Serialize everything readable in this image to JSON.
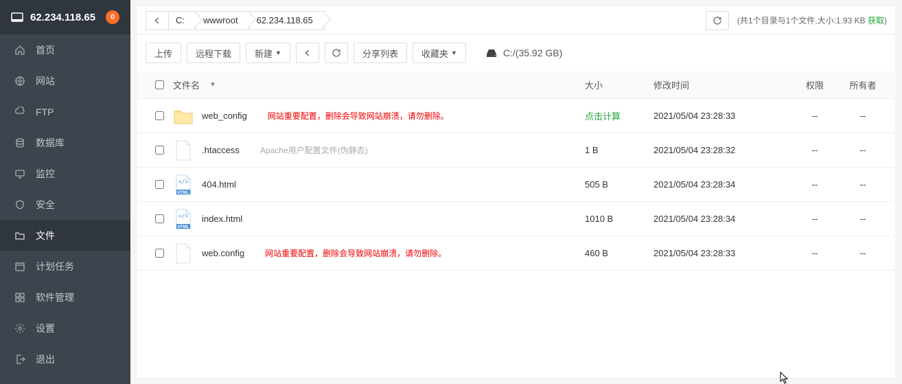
{
  "header": {
    "ip": "62.234.118.65",
    "badge": "0"
  },
  "sidebar": {
    "items": [
      {
        "key": "home",
        "label": "首页"
      },
      {
        "key": "site",
        "label": "网站"
      },
      {
        "key": "ftp",
        "label": "FTP"
      },
      {
        "key": "db",
        "label": "数据库"
      },
      {
        "key": "monitor",
        "label": "监控"
      },
      {
        "key": "security",
        "label": "安全"
      },
      {
        "key": "files",
        "label": "文件",
        "active": true
      },
      {
        "key": "cron",
        "label": "计划任务"
      },
      {
        "key": "soft",
        "label": "软件管理"
      },
      {
        "key": "settings",
        "label": "设置"
      },
      {
        "key": "logout",
        "label": "退出"
      }
    ]
  },
  "breadcrumb": {
    "segments": [
      "C:",
      "wwwroot",
      "62.234.118.65"
    ],
    "summary_prefix": "(共1个目录与1个文件,大小:1.93 KB",
    "summary_link": "获取",
    "summary_suffix": ")"
  },
  "toolbar": {
    "upload": "上传",
    "remote_dl": "远程下载",
    "new": "新建",
    "share_list": "分享列表",
    "favorites": "收藏夹",
    "disk_label": "C:/(35.92 GB)"
  },
  "table": {
    "headers": {
      "filename": "文件名",
      "size": "大小",
      "mtime": "修改时间",
      "perm": "权限",
      "owner": "所有者"
    },
    "rows": [
      {
        "icon": "folder",
        "name": "web_config",
        "note": "网站重要配置，删除会导致网站崩溃，请勿删除。",
        "note_style": "red",
        "size": "点击计算",
        "size_link": true,
        "mtime": "2021/05/04 23:28:33",
        "perm": "--",
        "owner": "--"
      },
      {
        "icon": "file",
        "name": ".htaccess",
        "note": "Apache用户配置文件(伪静态)",
        "note_style": "grey",
        "size": "1 B",
        "mtime": "2021/05/04 23:28:32",
        "perm": "--",
        "owner": "--"
      },
      {
        "icon": "html",
        "name": "404.html",
        "size": "505 B",
        "mtime": "2021/05/04 23:28:34",
        "perm": "--",
        "owner": "--"
      },
      {
        "icon": "html",
        "name": "index.html",
        "size": "1010 B",
        "mtime": "2021/05/04 23:28:34",
        "perm": "--",
        "owner": "--"
      },
      {
        "icon": "file",
        "name": "web.config",
        "note": "网站重要配置，删除会导致网站崩溃，请勿删除。",
        "note_style": "red",
        "size": "460 B",
        "mtime": "2021/05/04 23:28:33",
        "perm": "--",
        "owner": "--"
      }
    ]
  }
}
